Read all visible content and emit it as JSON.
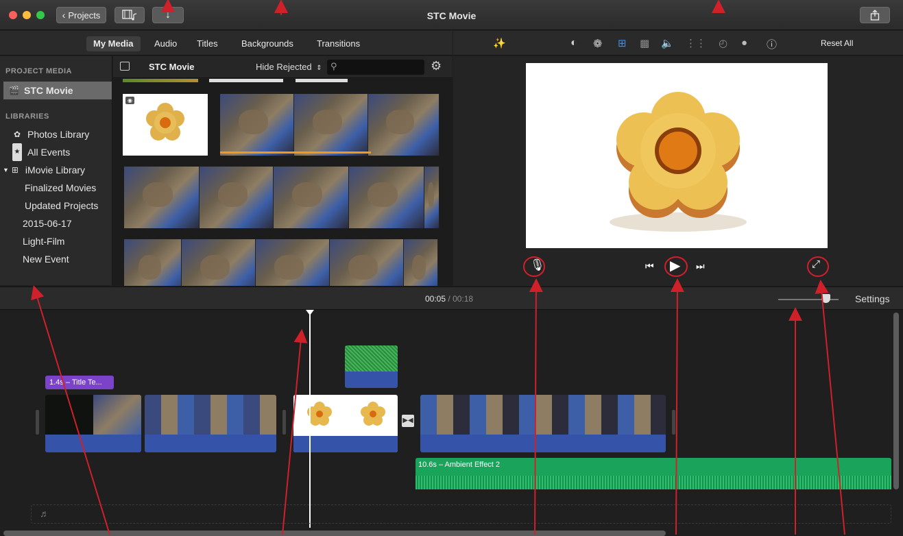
{
  "window": {
    "title": "STC Movie"
  },
  "toolbar": {
    "projects_label": "Projects",
    "projects_icon": "chevron-left-icon",
    "media_icon": "film-music-icon",
    "import_icon": "download-arrow-icon",
    "share_icon": "share-icon"
  },
  "browser_tabs": [
    {
      "label": "My Media",
      "active": true
    },
    {
      "label": "Audio",
      "active": false
    },
    {
      "label": "Titles",
      "active": false
    },
    {
      "label": "Backgrounds",
      "active": false
    },
    {
      "label": "Transitions",
      "active": false
    }
  ],
  "sidebar": {
    "project_media_header": "PROJECT MEDIA",
    "project_item": "STC Movie",
    "libraries_header": "LIBRARIES",
    "items": [
      {
        "label": "Photos Library",
        "icon": "photos-icon"
      },
      {
        "label": "All Events",
        "icon": "star-icon"
      },
      {
        "label": "iMovie Library",
        "icon": "grid-icon"
      },
      {
        "label": "Finalized Movies"
      },
      {
        "label": "Updated Projects"
      },
      {
        "label": "2015-06-17"
      },
      {
        "label": "Light-Film"
      },
      {
        "label": "New Event"
      }
    ]
  },
  "media_header": {
    "title": "STC Movie",
    "filter": "Hide Rejected",
    "search_placeholder": ""
  },
  "viewer": {
    "reset_all": "Reset All",
    "tools": [
      "magic-wand-icon",
      "color-balance-icon",
      "color-palette-icon",
      "crop-icon",
      "stabilize-icon",
      "volume-icon",
      "equalizer-icon",
      "speed-icon",
      "filter-icon",
      "info-icon"
    ]
  },
  "timeline": {
    "timecode_current": "00:05",
    "timecode_sep": "/",
    "timecode_total": "00:18",
    "settings_label": "Settings",
    "title_clip_label": "1.4s – Title Te...",
    "audio_clip_label": "10.6s – Ambient Effect 2"
  },
  "colors": {
    "accent_blue": "#3553a8",
    "title_purple": "#7a43c9",
    "audio_green": "#1aa35a",
    "annotation_red": "#d0202a"
  }
}
